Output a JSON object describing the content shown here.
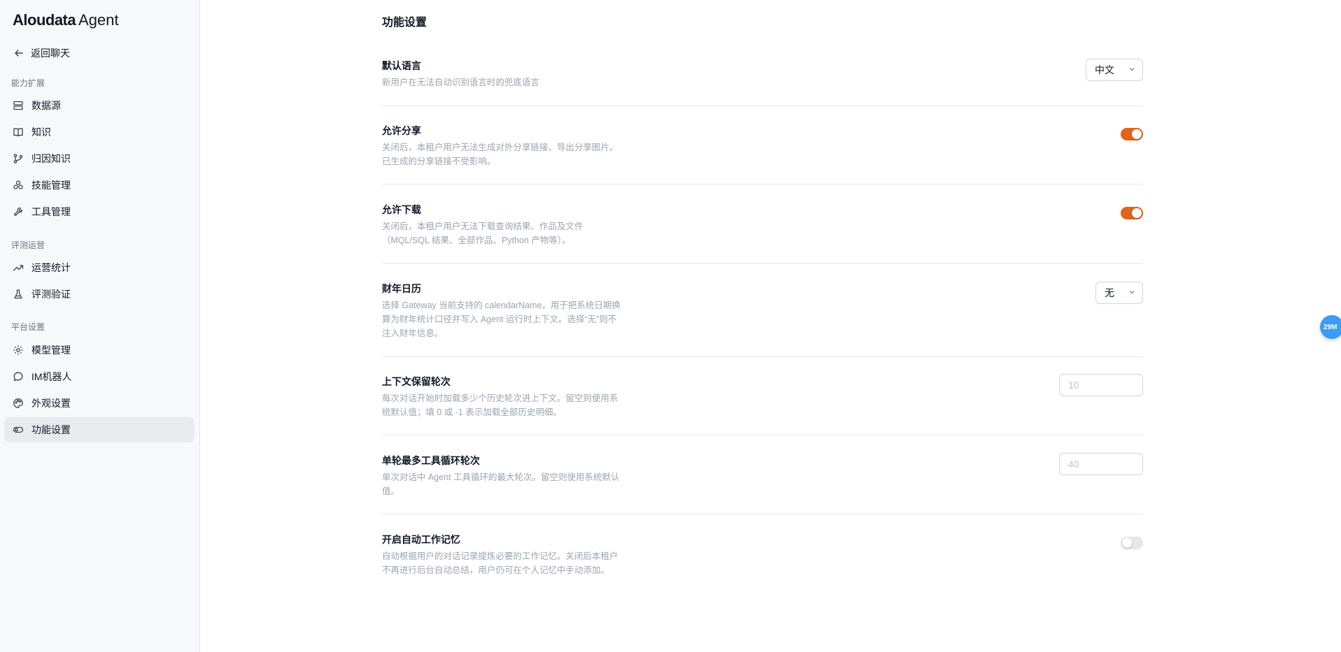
{
  "brand": {
    "name": "Aloudata",
    "suffix": "Agent"
  },
  "back": {
    "label": "返回聊天",
    "icon": "arrow-left-icon"
  },
  "sidebar": {
    "sections": [
      {
        "label": "能力扩展",
        "items": [
          {
            "label": "数据源",
            "icon": "database-icon"
          },
          {
            "label": "知识",
            "icon": "book-icon"
          },
          {
            "label": "归因知识",
            "icon": "git-branch-icon"
          },
          {
            "label": "技能管理",
            "icon": "skills-icon"
          },
          {
            "label": "工具管理",
            "icon": "wrench-icon"
          }
        ]
      },
      {
        "label": "评测运营",
        "items": [
          {
            "label": "运营统计",
            "icon": "trending-up-icon"
          },
          {
            "label": "评测验证",
            "icon": "flask-icon"
          }
        ]
      },
      {
        "label": "平台设置",
        "items": [
          {
            "label": "模型管理",
            "icon": "gear-icon"
          },
          {
            "label": "IM机器人",
            "icon": "chat-bubble-icon"
          },
          {
            "label": "外观设置",
            "icon": "palette-icon"
          },
          {
            "label": "功能设置",
            "icon": "toggle-icon",
            "active": true
          }
        ]
      }
    ]
  },
  "page": {
    "title": "功能设置"
  },
  "settings": {
    "language": {
      "title": "默认语言",
      "desc": "新用户在无法自动识别语言时的兜底语言",
      "value": "中文"
    },
    "share": {
      "title": "允许分享",
      "desc1": "关闭后，本租户用户无法生成对外分享链接、导出分享图片。",
      "desc2": "已生成的分享链接不受影响。",
      "enabled": true
    },
    "download": {
      "title": "允许下载",
      "desc1": "关闭后，本租户用户无法下载查询结果、作品及文件",
      "desc2": "（MQL/SQL 结果、全部作品、Python 产物等）。",
      "enabled": true
    },
    "fiscal": {
      "title": "财年日历",
      "desc1": "选择 Gateway 当前支持的 calendarName，用于把系统日期换",
      "desc2": "算为财年统计口径并写入 Agent 运行时上下文。选择“无”则不",
      "desc3": "注入财年信息。",
      "value": "无"
    },
    "context": {
      "title": "上下文保留轮次",
      "desc1": "每次对话开始时加载多少个历史轮次进上下文。留空则使用系",
      "desc2": "统默认值；填 0 或 -1 表示加载全部历史明细。",
      "placeholder": "10"
    },
    "tool_loop": {
      "title": "单轮最多工具循环轮次",
      "desc1": "单次对话中 Agent 工具循环的最大轮次。留空则使用系统默认",
      "desc2": "值。",
      "placeholder": "40"
    },
    "memory": {
      "title": "开启自动工作记忆",
      "desc1": "自动根据用户的对话记录提炼必要的工作记忆。关闭后本租户",
      "desc2": "不再进行后台自动总结，用户仍可在个人记忆中手动添加。",
      "enabled": false
    }
  },
  "float_badge": {
    "label": "29M"
  },
  "colors": {
    "accent": "#e0641a",
    "badge": "#3b9bf5"
  }
}
